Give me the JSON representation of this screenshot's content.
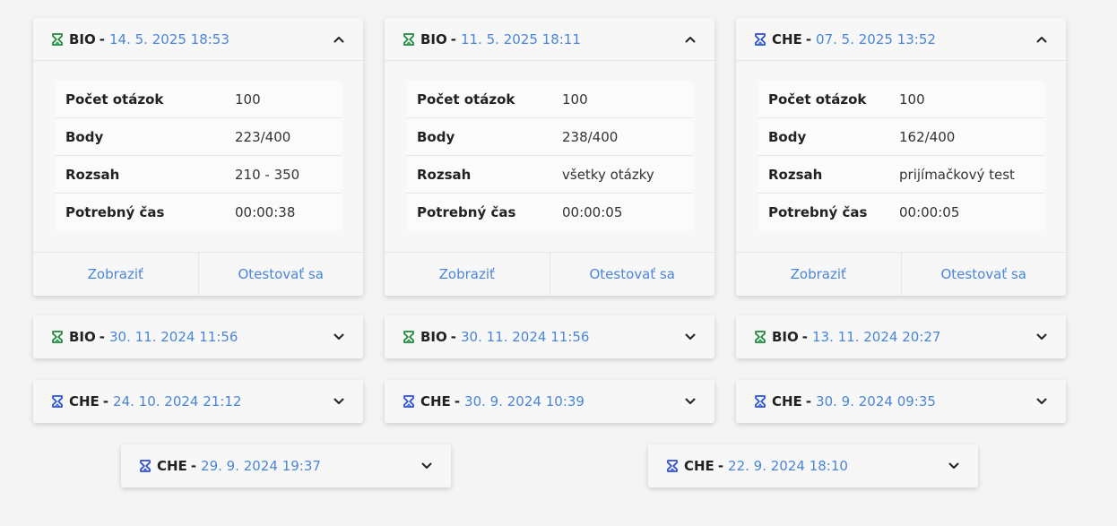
{
  "colors": {
    "bio_icon": "#1e8a3c",
    "che_icon": "#2a4fd6",
    "date": "#4a86d8"
  },
  "labels": {
    "questions": "Počet otázok",
    "points": "Body",
    "range": "Rozsah",
    "time": "Potrebný čas",
    "show": "Zobraziť",
    "retest": "Otestovať sa",
    "separator": "-"
  },
  "expanded": [
    {
      "subject": "BIO",
      "date": "14. 5. 2025 18:53",
      "questions": "100",
      "points": "223/400",
      "range": "210 - 350",
      "time": "00:00:38"
    },
    {
      "subject": "BIO",
      "date": "11. 5. 2025 18:11",
      "questions": "100",
      "points": "238/400",
      "range": "všetky otázky",
      "time": "00:00:05"
    },
    {
      "subject": "CHE",
      "date": "07. 5. 2025 13:52",
      "questions": "100",
      "points": "162/400",
      "range": "prijímačkový test",
      "time": "00:00:05"
    }
  ],
  "collapsed": [
    {
      "subject": "BIO",
      "date": "30. 11. 2024 11:56"
    },
    {
      "subject": "BIO",
      "date": "30. 11. 2024 11:56"
    },
    {
      "subject": "BIO",
      "date": "13. 11. 2024 20:27"
    },
    {
      "subject": "CHE",
      "date": "24. 10. 2024 21:12"
    },
    {
      "subject": "CHE",
      "date": "30. 9. 2024 10:39"
    },
    {
      "subject": "CHE",
      "date": "30. 9. 2024 09:35"
    },
    {
      "subject": "CHE",
      "date": "29. 9. 2024 19:37"
    },
    {
      "subject": "CHE",
      "date": "22. 9. 2024 18:10"
    }
  ]
}
